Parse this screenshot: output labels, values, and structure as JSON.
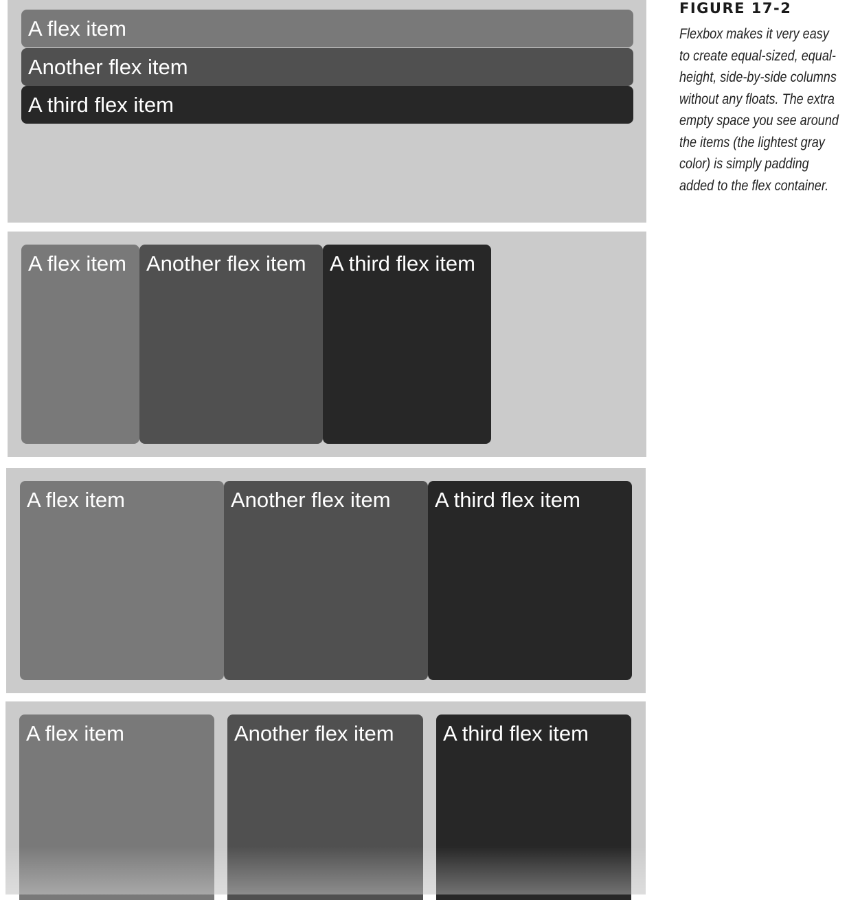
{
  "panels": [
    {
      "items": [
        "A flex item",
        "Another flex item",
        "A third flex item"
      ]
    },
    {
      "items": [
        "A flex item",
        "Another flex item",
        "A third flex item"
      ]
    },
    {
      "items": [
        "A flex item",
        "Another flex item",
        "A third flex item"
      ]
    },
    {
      "items": [
        "A flex item",
        "Another flex item",
        "A third flex item"
      ]
    }
  ],
  "caption": {
    "label": "FIGURE 17-2",
    "text": "Flexbox makes it very easy to create equal-sized, equal-height, side-by-side columns without any floats. The extra empty space you see around the items (the lightest gray color) is simply padding added to the flex container."
  },
  "colors": {
    "container": "#cbcbcb",
    "item_1": "#797979",
    "item_2": "#505050",
    "item_3": "#272727"
  }
}
